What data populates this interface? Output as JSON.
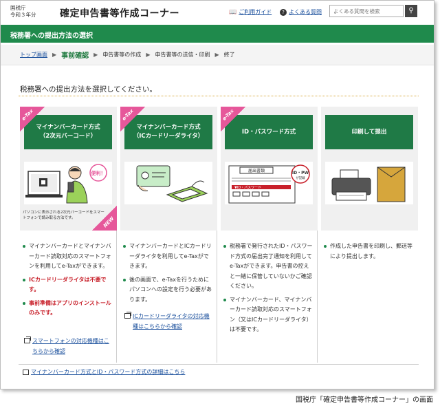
{
  "header": {
    "org_line1": "国税庁",
    "org_line2": "令和３年分",
    "title": "確定申告書等作成コーナー",
    "guide_link": "ご利用ガイド",
    "faq_link": "よくある質問",
    "search_placeholder": "よくある質問を検索"
  },
  "section_title": "税務署への提出方法の選択",
  "steps": [
    {
      "label": "トップ画面"
    },
    {
      "label": "事前確認"
    },
    {
      "label": "申告書等の作成"
    },
    {
      "label": "申告書等の送信・印刷"
    },
    {
      "label": "終了"
    }
  ],
  "instruction": "税務署への提出方法を選択してください。",
  "cards": [
    {
      "badge": "e-Tax",
      "title_line1": "マイナンバーカード方式",
      "title_line2": "（2次元バーコード）",
      "illustration_label": "便利！",
      "caption": "パソコンに表示される2次元バーコードをスマートフォンで読み取る方法です。",
      "new_badge": "NEW",
      "bullets": [
        {
          "text": "マイナンバーカードとマイナンバーカード読取対応のスマートフォンを利用してe-Taxができます。"
        },
        {
          "text": "ICカードリーダライタは不要です。"
        },
        {
          "text": "事前準備はアプリのインストールのみです。"
        }
      ],
      "link": "スマートフォンの対応機種はこちらから確認"
    },
    {
      "badge": "e-Tax",
      "title_line1": "マイナンバーカード方式",
      "title_line2": "（ICカードリーダライタ）",
      "bullets": [
        {
          "text": "マイナンバーカードとICカードリーダライタを利用してe-Taxができます。"
        },
        {
          "text": "後の画面で、e-Taxを行うためにパソコンへの設定を行う必要があります。"
        }
      ],
      "link": "ICカードリーダライタの対応機種はこちらから確認"
    },
    {
      "badge": "e-Tax",
      "title_line1": "ID・パスワード方式",
      "illustration_doc": "届出書類",
      "illustration_id": "ID・PW",
      "illustration_id_sub": "が記載",
      "illustration_banner": "▼ID・パスワード",
      "bullets": [
        {
          "text": "税務署で発行されたID・パスワード方式の届出完了通知を利用してe-Taxができます。申告書の控えと一緒に保管していないかご確認ください。"
        },
        {
          "text": "マイナンバーカード、マイナンバーカード読取対応のスマートフォン（又はICカードリーダライタ）は不要です。"
        }
      ]
    },
    {
      "title_line1": "印刷して提出",
      "bullets": [
        {
          "text": "作成した申告書を印刷し、郵送等により提出します。"
        }
      ]
    }
  ],
  "detail_link": "マイナンバーカード方式とID・パスワード方式の詳細はこちら",
  "footer_caption": "国税庁「確定申告書等作成コーナー」の画面",
  "colors": {
    "green": "#1f8a4c",
    "card_green": "#1f7a46",
    "pink": "#e6579a",
    "link": "#1a4f9c",
    "red": "#c8202a"
  }
}
